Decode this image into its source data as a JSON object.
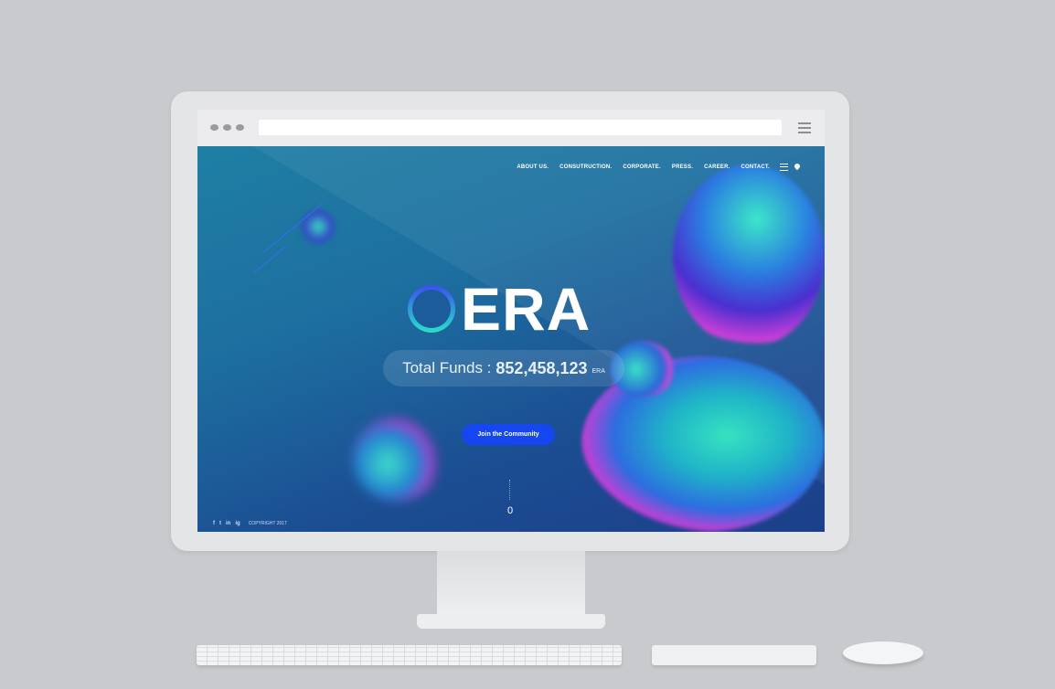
{
  "nav": {
    "items": [
      "ABOUT US.",
      "CONSUTRUCTION.",
      "CORPORATE.",
      "PRESS.",
      "CAREER.",
      "CONTACT."
    ]
  },
  "hero": {
    "logo_text": "ERA",
    "funds_label": "Total Funds :",
    "funds_value": "852,458,123",
    "funds_unit": "ERA",
    "cta_label": "Join the Community"
  },
  "scroll_indicator": "0",
  "footer": {
    "social": [
      "f",
      "t",
      "in",
      "ig"
    ],
    "copyright": "COPYRIGHT 2017"
  },
  "colors": {
    "cta": "#1646f0",
    "background": "#c8cacd"
  }
}
